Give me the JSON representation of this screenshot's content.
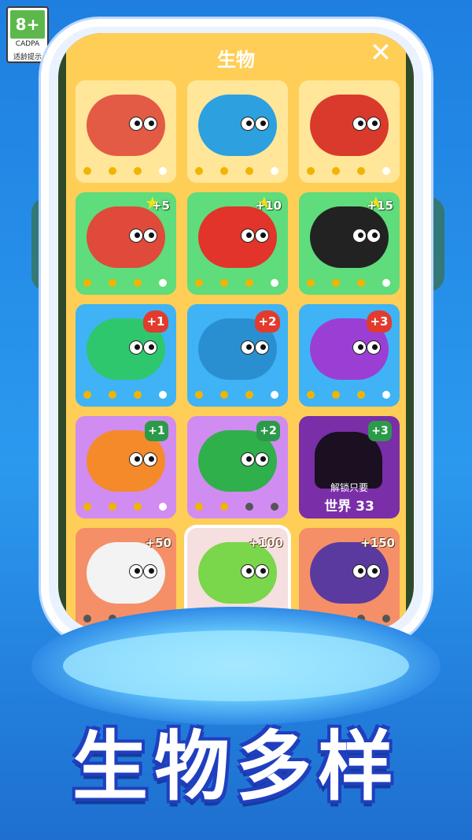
{
  "age_rating": {
    "label": "8+",
    "org": "CADPA",
    "note": "适龄提示"
  },
  "panel": {
    "title": "生物",
    "close": "✕"
  },
  "cards": [
    {
      "bg": "c-yellow",
      "color": "#e35a45",
      "badge": "",
      "dots": [
        "on",
        "on",
        "on",
        "off"
      ]
    },
    {
      "bg": "c-yellow",
      "color": "#2da0e0",
      "badge": "",
      "dots": [
        "on",
        "on",
        "on",
        "off"
      ]
    },
    {
      "bg": "c-yellow",
      "color": "#d93a2b",
      "badge": "",
      "dots": [
        "on",
        "on",
        "on",
        "off"
      ]
    },
    {
      "bg": "c-green",
      "color": "#e04a3a",
      "badge": "+5",
      "badge_type": "star",
      "dots": [
        "on",
        "on",
        "on",
        "off"
      ]
    },
    {
      "bg": "c-green",
      "color": "#e2342a",
      "badge": "+10",
      "badge_type": "star",
      "dots": [
        "on",
        "on",
        "on",
        "off"
      ]
    },
    {
      "bg": "c-green",
      "color": "#222222",
      "badge": "+15",
      "badge_type": "star",
      "dots": [
        "on",
        "on",
        "on",
        "off"
      ]
    },
    {
      "bg": "c-blue",
      "color": "#2ec76e",
      "badge": "+1",
      "badge_type": "paw",
      "dots": [
        "on",
        "on",
        "on",
        "off"
      ]
    },
    {
      "bg": "c-blue",
      "color": "#2a8fd0",
      "badge": "+2",
      "badge_type": "paw",
      "dots": [
        "on",
        "on",
        "on",
        "off"
      ]
    },
    {
      "bg": "c-blue",
      "color": "#9b3fd4",
      "badge": "+3",
      "badge_type": "paw",
      "dots": [
        "on",
        "on",
        "on",
        "off"
      ]
    },
    {
      "bg": "c-purple",
      "color": "#f58a2a",
      "badge": "+1",
      "badge_type": "gem",
      "dots": [
        "on",
        "on",
        "on",
        "off"
      ]
    },
    {
      "bg": "c-purple",
      "color": "#2fb04a",
      "badge": "+2",
      "badge_type": "gem",
      "dots": [
        "on",
        "on",
        "gray",
        "gray"
      ]
    },
    {
      "bg": "c-dark",
      "color": "#1b0f22",
      "badge": "+3",
      "badge_type": "gem",
      "locked": true,
      "locked_line1": "解锁只要",
      "locked_line2": "世界 33"
    },
    {
      "bg": "c-salmon",
      "color": "#f3f3f3",
      "badge": "+50",
      "badge_type": "plus",
      "dots": [
        "gray",
        "gray",
        "gray",
        "gray"
      ]
    },
    {
      "bg": "c-selected",
      "color": "#7ad64a",
      "badge": "+100",
      "badge_type": "plus",
      "dots": [
        "off",
        "gray",
        "gray",
        "gray"
      ]
    },
    {
      "bg": "c-salmon",
      "color": "#5b3aa0",
      "badge": "+150",
      "badge_type": "plus",
      "dots": [
        "off",
        "off",
        "gray",
        "gray"
      ]
    }
  ],
  "hero_title": "生物多样"
}
